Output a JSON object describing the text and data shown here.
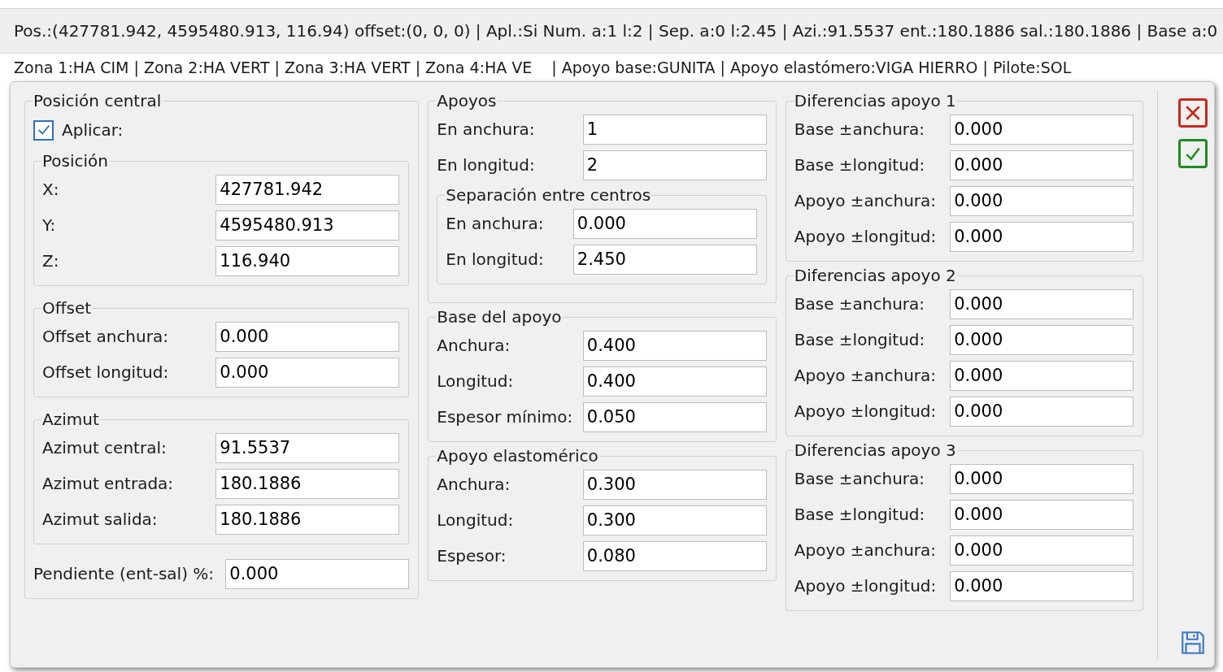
{
  "status_bar": {
    "line_1": "Pos.:(427781.942, 4595480.913, 116.94) offset:(0, 0, 0) | Apl.:Si Num. a:1 l:2 | Sep. a:0 l:2.45 | Azi.:91.5537 ent.:180.1886 sal.:180.1886 | Base a:0",
    "line_2": [
      "Zona 1:HA CIM | Zona 2:HA VERT | Zona 3:HA VERT | Zona 4:HA VE",
      "| Apoyo base:GUNITA | Apoyo elastómero:VIGA HIERRO | Pilote:SOL"
    ]
  },
  "columns": [
    [
      {
        "title": "Posición central",
        "items": [
          {
            "kind": "checkbox",
            "label": "Aplicar:",
            "checked": true
          },
          {
            "kind": "group",
            "title": "Posición",
            "items": [
              {
                "kind": "field",
                "label": "X:",
                "value": "427781.942"
              },
              {
                "kind": "field",
                "label": "Y:",
                "value": "4595480.913"
              },
              {
                "kind": "field",
                "label": "Z:",
                "value": "116.940"
              }
            ]
          },
          {
            "kind": "group",
            "title": "Offset",
            "items": [
              {
                "kind": "field",
                "label": "Offset anchura:",
                "value": "0.000"
              },
              {
                "kind": "field",
                "label": "Offset longitud:",
                "value": "0.000"
              }
            ]
          },
          {
            "kind": "group",
            "title": "Azimut",
            "items": [
              {
                "kind": "field",
                "label": "Azimut central:",
                "value": "91.5537"
              },
              {
                "kind": "field",
                "label": "Azimut entrada:",
                "value": "180.1886"
              },
              {
                "kind": "field",
                "label": "Azimut salida:",
                "value": "180.1886"
              }
            ]
          },
          {
            "kind": "field",
            "label": "Pendiente (ent-sal) %:",
            "value": "0.000"
          }
        ]
      }
    ],
    [
      {
        "title": "Apoyos",
        "items": [
          {
            "kind": "field",
            "label": "En anchura:",
            "value": "1"
          },
          {
            "kind": "field",
            "label": "En longitud:",
            "value": "2"
          },
          {
            "kind": "group",
            "title": "Separación entre centros",
            "items": [
              {
                "kind": "field",
                "label": "En anchura:",
                "value": "0.000"
              },
              {
                "kind": "field",
                "label": "En longitud:",
                "value": "2.450"
              }
            ]
          }
        ]
      },
      {
        "title": "Base del apoyo",
        "items": [
          {
            "kind": "field",
            "label": "Anchura:",
            "value": "0.400"
          },
          {
            "kind": "field",
            "label": "Longitud:",
            "value": "0.400"
          },
          {
            "kind": "field",
            "label": "Espesor mínimo:",
            "value": "0.050"
          }
        ]
      },
      {
        "title": "Apoyo elastomérico",
        "items": [
          {
            "kind": "field",
            "label": "Anchura:",
            "value": "0.300"
          },
          {
            "kind": "field",
            "label": "Longitud:",
            "value": "0.300"
          },
          {
            "kind": "field",
            "label": "Espesor:",
            "value": "0.080"
          }
        ]
      }
    ],
    [
      {
        "title": "Diferencias apoyo 1",
        "items": [
          {
            "kind": "field",
            "label": "Base ±anchura:",
            "value": "0.000"
          },
          {
            "kind": "field",
            "label": "Base ±longitud:",
            "value": "0.000"
          },
          {
            "kind": "field",
            "label": "Apoyo ±anchura:",
            "value": "0.000"
          },
          {
            "kind": "field",
            "label": "Apoyo ±longitud:",
            "value": "0.000"
          }
        ]
      },
      {
        "title": "Diferencias apoyo 2",
        "items": [
          {
            "kind": "field",
            "label": "Base ±anchura:",
            "value": "0.000"
          },
          {
            "kind": "field",
            "label": "Base ±longitud:",
            "value": "0.000"
          },
          {
            "kind": "field",
            "label": "Apoyo ±anchura:",
            "value": "0.000"
          },
          {
            "kind": "field",
            "label": "Apoyo ±longitud:",
            "value": "0.000"
          }
        ]
      },
      {
        "title": "Diferencias apoyo 3",
        "items": [
          {
            "kind": "field",
            "label": "Base ±anchura:",
            "value": "0.000"
          },
          {
            "kind": "field",
            "label": "Base ±longitud:",
            "value": "0.000"
          },
          {
            "kind": "field",
            "label": "Apoyo ±anchura:",
            "value": "0.000"
          },
          {
            "kind": "field",
            "label": "Apoyo ±longitud:",
            "value": "0.000"
          }
        ]
      }
    ]
  ]
}
